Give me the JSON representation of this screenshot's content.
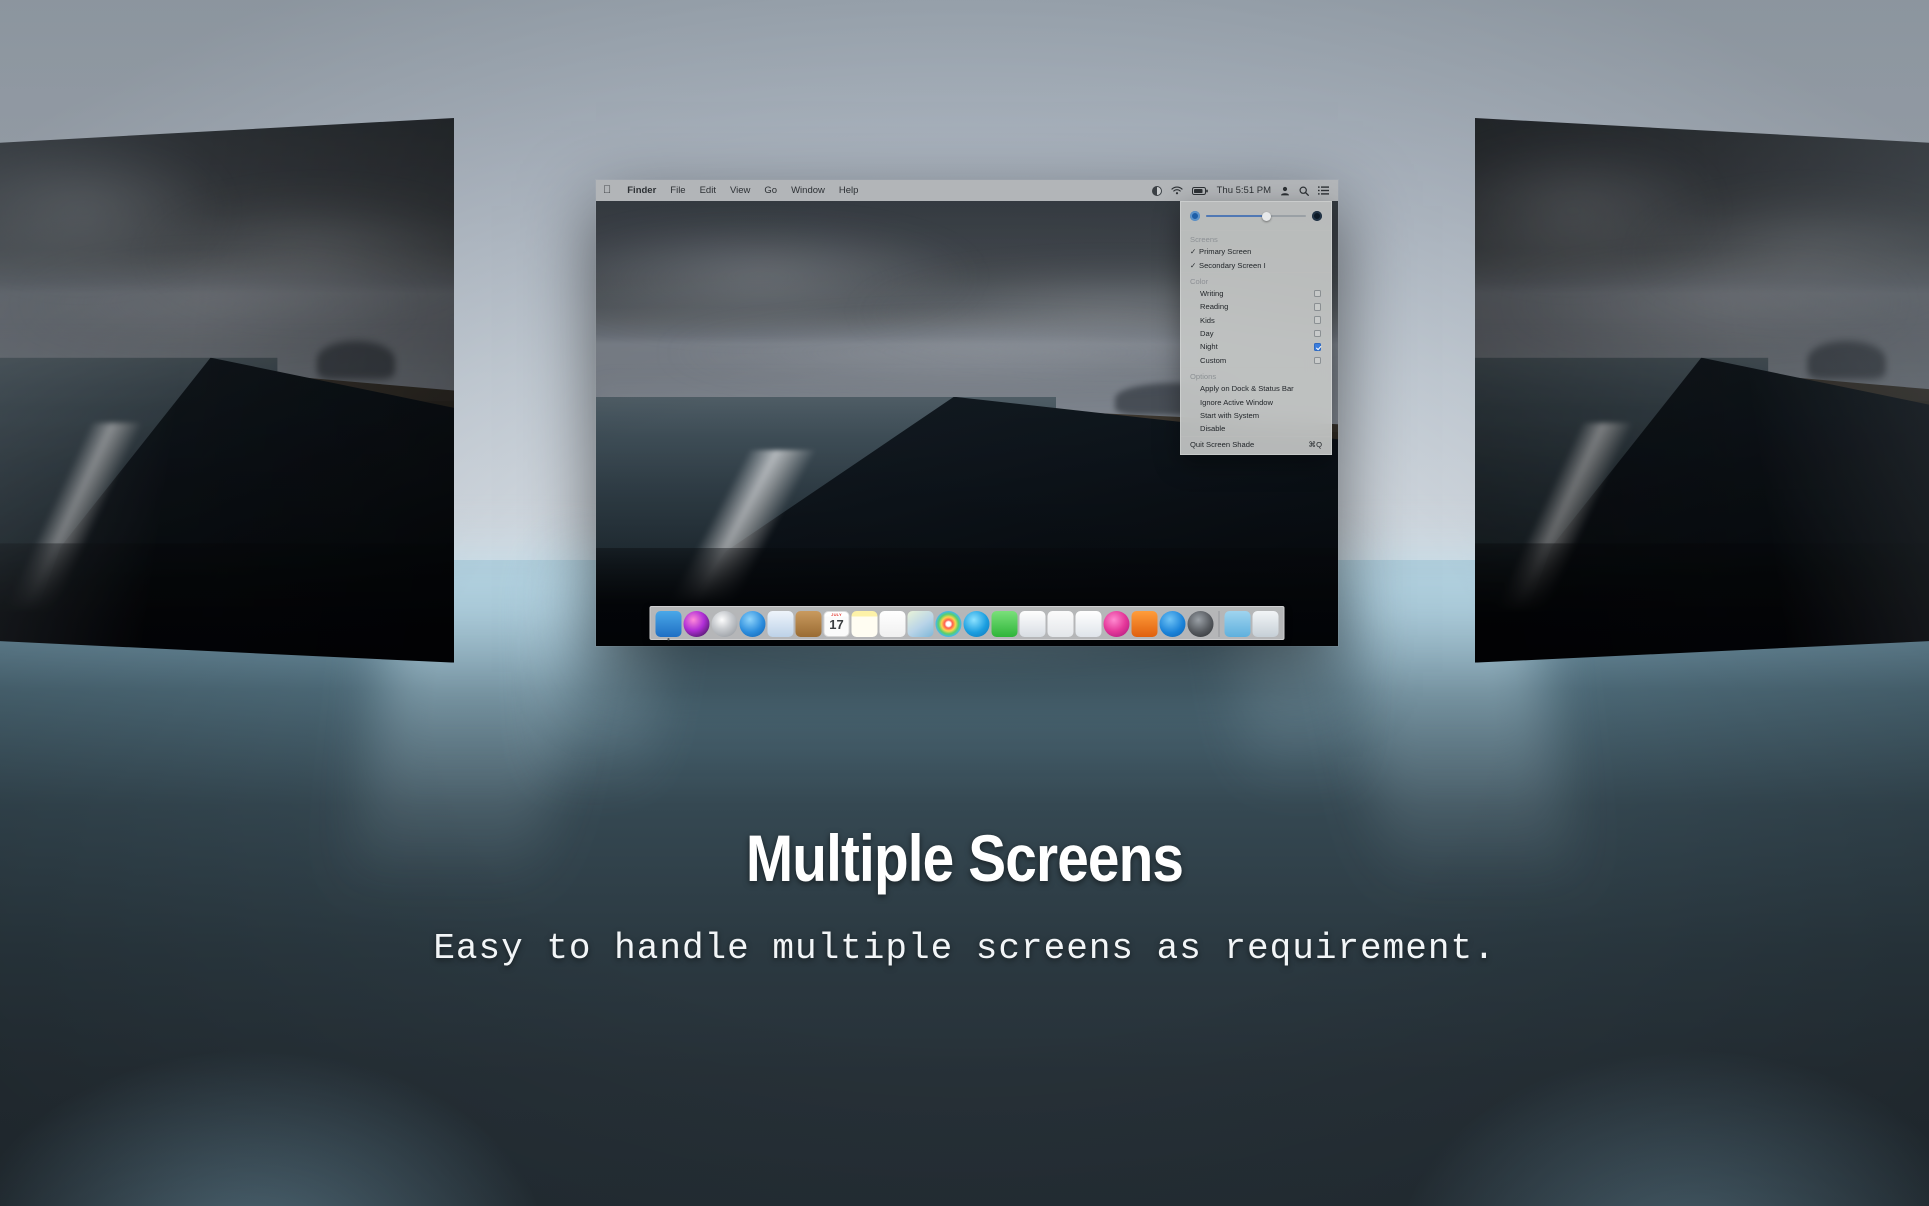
{
  "caption": {
    "title": "Multiple Screens",
    "subtitle": "Easy to handle multiple screens as requirement."
  },
  "menubar": {
    "apple_logo": "",
    "items": [
      "Finder",
      "File",
      "Edit",
      "View",
      "Go",
      "Window",
      "Help"
    ],
    "clock": "Thu 5:51 PM",
    "status_icons": [
      "screen-shade-icon",
      "wifi-icon",
      "battery-icon",
      "user-icon",
      "search-icon",
      "list-icon"
    ]
  },
  "popup": {
    "slider": {
      "left_icon": "brightness-low-icon",
      "right_icon": "brightness-dark-icon",
      "value_percent": 60
    },
    "screens_label": "Screens",
    "screens": [
      {
        "label": "Primary Screen",
        "checked": true,
        "mark": "✓"
      },
      {
        "label": "Secondary Screen I",
        "checked": true,
        "mark": "✓"
      }
    ],
    "color_label": "Color",
    "colors": [
      {
        "label": "Writing",
        "checked": false
      },
      {
        "label": "Reading",
        "checked": false
      },
      {
        "label": "Kids",
        "checked": false
      },
      {
        "label": "Day",
        "checked": false
      },
      {
        "label": "Night",
        "checked": true
      },
      {
        "label": "Custom",
        "checked": false
      }
    ],
    "options_label": "Options",
    "options": [
      {
        "label": "Apply on Dock & Status Bar"
      },
      {
        "label": "Ignore Active Window"
      },
      {
        "label": "Start with System"
      },
      {
        "label": "Disable"
      }
    ],
    "quit": {
      "label": "Quit Screen Shade",
      "shortcut": "⌘Q"
    }
  },
  "dock": {
    "items": [
      {
        "name": "finder-icon",
        "running": true
      },
      {
        "name": "siri-icon",
        "running": false
      },
      {
        "name": "launchpad-icon",
        "running": false
      },
      {
        "name": "safari-icon",
        "running": false
      },
      {
        "name": "mail-icon",
        "running": false
      },
      {
        "name": "contacts-icon",
        "running": false
      },
      {
        "name": "calendar-icon",
        "running": false
      },
      {
        "name": "notes-icon",
        "running": false
      },
      {
        "name": "reminders-icon",
        "running": false
      },
      {
        "name": "maps-icon",
        "running": false
      },
      {
        "name": "photos-icon",
        "running": false
      },
      {
        "name": "messages-icon",
        "running": false
      },
      {
        "name": "facetime-icon",
        "running": false
      },
      {
        "name": "pages-icon",
        "running": false
      },
      {
        "name": "numbers-icon",
        "running": false
      },
      {
        "name": "keynote-icon",
        "running": false
      },
      {
        "name": "itunes-icon",
        "running": false
      },
      {
        "name": "ibooks-icon",
        "running": false
      },
      {
        "name": "app-store-icon",
        "running": false
      },
      {
        "name": "system-preferences-icon",
        "running": false
      },
      {
        "name": "downloads-folder-icon",
        "running": false
      },
      {
        "name": "trash-icon",
        "running": false
      }
    ],
    "calendar_day": "17",
    "calendar_month": "JULY"
  },
  "screens": {
    "left_label": "secondary-screen-left",
    "center_label": "primary-screen-center",
    "right_label": "secondary-screen-right"
  },
  "colors": {
    "accent": "#3b7ddd",
    "slider_fill": "#5078b4",
    "backdrop_top": "#b3bfcb",
    "floor_bottom": "#252f36",
    "caption_text": "#ffffff"
  }
}
